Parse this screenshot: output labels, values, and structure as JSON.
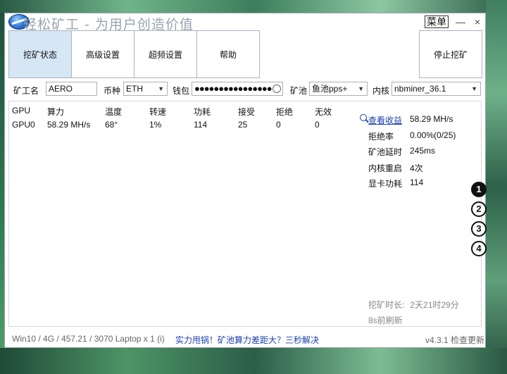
{
  "window": {
    "title": "轻松矿工 - 为用户创造价值",
    "menu_label": "菜单",
    "minimize": "—",
    "close": "×"
  },
  "tabs": [
    {
      "label": "挖矿状态",
      "active": true
    },
    {
      "label": "高级设置",
      "active": false
    },
    {
      "label": "超频设置",
      "active": false
    },
    {
      "label": "帮助",
      "active": false
    }
  ],
  "stop_button": "停止挖矿",
  "form": {
    "worker_label": "矿工名",
    "worker_value": "AERO",
    "coin_label": "币种",
    "coin_value": "ETH",
    "wallet_label": "钱包",
    "wallet_value": "●●●●●●●●●●●●●●●●",
    "pool_label": "矿池",
    "pool_value": "鱼池pps+",
    "kernel_label": "内核",
    "kernel_value": "nbminer_36.1"
  },
  "gpu_table": {
    "headers": [
      "GPU",
      "算力",
      "温度",
      "转速",
      "功耗",
      "接受",
      "拒绝",
      "无效"
    ],
    "rows": [
      [
        "GPU0",
        "58.29 MH/s",
        "68°",
        "1%",
        "114",
        "25",
        "0",
        "0"
      ]
    ]
  },
  "stats": {
    "view_earnings": "查看收益",
    "hashrate": "58.29 MH/s",
    "reject_label": "拒绝率",
    "reject_value": "0.00%(0/25)",
    "latency_label": "矿池延时",
    "latency_value": "245ms",
    "restart_label": "内核重启",
    "restart_value": "4次",
    "power_label": "显卡功耗",
    "power_value": "114"
  },
  "mining_time": {
    "label": "挖矿时长:",
    "value": "2天21时29分"
  },
  "refreshed": "8s前刷新",
  "statusbar": {
    "sys_info": "Win10 / 4G / 457.21 / 3070 Laptop x 1 (i)",
    "promo": "实力甩锅！矿池算力差距大？三秒解决",
    "version": "v4.3.1 检查更新"
  },
  "side_badges": [
    "1",
    "2",
    "3",
    "4"
  ]
}
